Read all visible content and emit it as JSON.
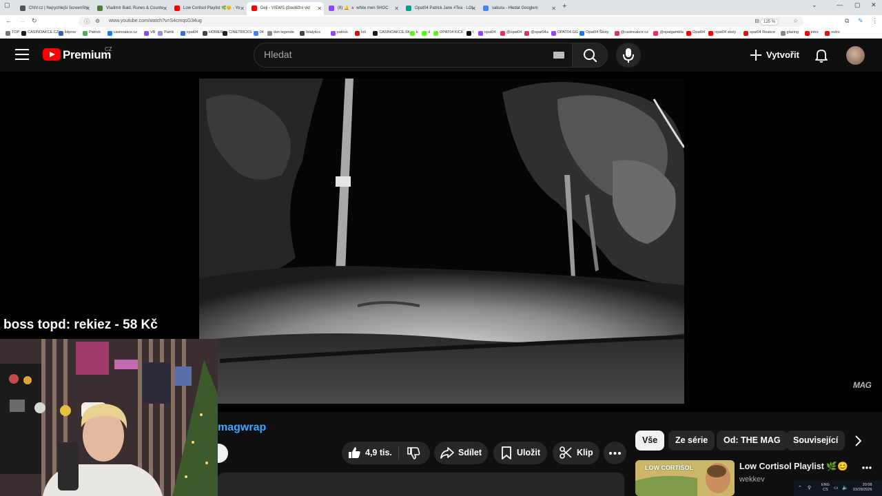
{
  "browser": {
    "tabs": [
      {
        "label": "ChIV.cz | Nejrychlejší ScreenShi",
        "color": "#555555"
      },
      {
        "label": "Vladimír Bald, Runes & Counte",
        "color": "#4b7a3a"
      },
      {
        "label": "Low Cortisol Playlist 🌿😊 - Yo",
        "color": "#ff0000"
      },
      {
        "label": "Deji - VIEWS (Soutěžní vid",
        "color": "#ff0000"
      },
      {
        "label": "(8) 🔔 🔺 white men SHOC",
        "color": "#9146ff"
      },
      {
        "label": "Opat04 Patrick Jane #Tea - LOL",
        "color": "#00a08a"
      },
      {
        "label": "sakura - Hledat Googlem",
        "color": "#4285f4"
      }
    ],
    "url": "www.youtube.com/watch?v=S4cmqsG34ug",
    "zoom": "125 %",
    "bookmarks": [
      {
        "label": "TOP",
        "color": "#777777"
      },
      {
        "label": "CASINOAKCE.CZ",
        "color": "#1d1d1d"
      },
      {
        "label": "lolpros",
        "color": "#2b62c7"
      },
      {
        "label": "Patrick",
        "color": "#4caf50"
      },
      {
        "label": "casinoakce.cz",
        "color": "#1877f2"
      },
      {
        "label": "VB",
        "color": "#9146ff"
      },
      {
        "label": "Patrik",
        "color": "#9a8cf0"
      },
      {
        "label": "opat04",
        "color": "#3b73c9"
      },
      {
        "label": "HOMER",
        "color": "#444444"
      },
      {
        "label": "CINETRICKS",
        "color": "#222222"
      },
      {
        "label": "04",
        "color": "#4285f4"
      },
      {
        "label": "don legende",
        "color": "#888888"
      },
      {
        "label": "lolalytics",
        "color": "#444444"
      },
      {
        "label": "patrick",
        "color": "#9146ff"
      },
      {
        "label": "loli",
        "color": "#ff0000"
      },
      {
        "label": "CASINOAKCE.SK",
        "color": "#1d1d1d"
      },
      {
        "label": "k",
        "color": "#53fc18"
      },
      {
        "label": "d",
        "color": "#53fc18"
      },
      {
        "label": "OPAT04 KICK",
        "color": "#53fc18"
      },
      {
        "label": "t",
        "color": "#111111"
      },
      {
        "label": "opat04",
        "color": "#9146ff"
      },
      {
        "label": "@opat04",
        "color": "#e1306c"
      },
      {
        "label": "@opat04a",
        "color": "#e1306c"
      },
      {
        "label": "OPAT04.GG",
        "color": "#9146ff"
      },
      {
        "label": "Opat04 Škoty",
        "color": "#1877f2"
      },
      {
        "label": "@casinoakce.cz",
        "color": "#e1306c"
      },
      {
        "label": "@opatgambla",
        "color": "#e1306c"
      },
      {
        "label": "Opat04",
        "color": "#ff0000"
      },
      {
        "label": "opat04 skoly",
        "color": "#ff0000"
      },
      {
        "label": "opat04 Reakce",
        "color": "#ff0000"
      },
      {
        "label": "glazing",
        "color": "#888888"
      },
      {
        "label": "intro",
        "color": "#ff0000"
      },
      {
        "label": "outro",
        "color": "#ff0000"
      }
    ]
  },
  "youtube": {
    "brand": "Premium",
    "country": "CZ",
    "search_placeholder": "Hledat",
    "create_label": "Vytvořit",
    "watermark": "MAG"
  },
  "overlay": {
    "donation_text": "boss topd:  rekiez - 58 Kč"
  },
  "video": {
    "channel_name": "magwrap",
    "like_count": "4,9 tis.",
    "share_label": "Sdílet",
    "save_label": "Uložit",
    "clip_label": "Klip"
  },
  "recommendations": {
    "chips": [
      "Vše",
      "Ze série",
      "Od: THE MAG",
      "Související"
    ],
    "first": {
      "thumb_text": "LOW CORTISOL",
      "title": "Low Cortisol Playlist 🌿😊",
      "channel": "wekkev"
    }
  },
  "taskbar": {
    "lang_top": "ENG",
    "lang_bottom": "CS",
    "time": "20:08",
    "date": "03/28/2026"
  }
}
